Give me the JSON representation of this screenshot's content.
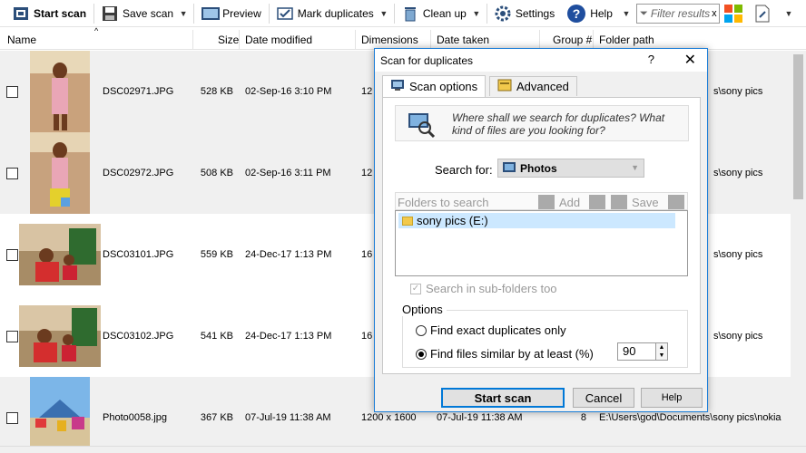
{
  "toolbar": {
    "start_scan": "Start scan",
    "save_scan": "Save scan",
    "preview": "Preview",
    "mark_duplicates": "Mark duplicates",
    "clean_up": "Clean up",
    "settings": "Settings",
    "help": "Help",
    "filter_placeholder": "Filter results",
    "filter_clear": "x"
  },
  "columns": {
    "name": "Name",
    "size": "Size",
    "date_modified": "Date modified",
    "dimensions": "Dimensions",
    "date_taken": "Date taken",
    "group": "Group #",
    "folder_path": "Folder path"
  },
  "rows": [
    {
      "name": "DSC02971.JPG",
      "size": "528 KB",
      "date_modified": "02-Sep-16 3:10 PM",
      "dimensions": "12",
      "date_taken": "",
      "group": "",
      "folder_path": "s\\sony pics"
    },
    {
      "name": "DSC02972.JPG",
      "size": "508 KB",
      "date_modified": "02-Sep-16 3:11 PM",
      "dimensions": "12",
      "date_taken": "",
      "group": "",
      "folder_path": "s\\sony pics"
    },
    {
      "name": "DSC03101.JPG",
      "size": "559 KB",
      "date_modified": "24-Dec-17 1:13 PM",
      "dimensions": "16",
      "date_taken": "",
      "group": "",
      "folder_path": "s\\sony pics"
    },
    {
      "name": "DSC03102.JPG",
      "size": "541 KB",
      "date_modified": "24-Dec-17 1:13 PM",
      "dimensions": "16",
      "date_taken": "",
      "group": "",
      "folder_path": "s\\sony pics"
    },
    {
      "name": "Photo0058.jpg",
      "size": "367 KB",
      "date_modified": "07-Jul-19 11:38 AM",
      "dimensions": "1200 x 1600",
      "date_taken": "07-Jul-19 11:38 AM",
      "group": "8",
      "folder_path": "E:\\Users\\god\\Documents\\sony pics\\nokia"
    }
  ],
  "dialog": {
    "title": "Scan for duplicates",
    "help_glyph": "?",
    "close_glyph": "✕",
    "tab_scan_options": "Scan options",
    "tab_advanced": "Advanced",
    "prompt": "Where shall we search for duplicates? What kind of files are you looking for?",
    "search_for_label": "Search for:",
    "search_for_value": "Photos",
    "folders_to_search": "Folders to search",
    "add_label": "Add",
    "save_label": "Save",
    "folder_item": "sony pics (E:)",
    "subfolders": "Search in sub-folders too",
    "options_label": "Options",
    "opt_exact": "Find exact duplicates only",
    "opt_similar": "Find files similar by at least (%)",
    "similarity_value": "90",
    "start_scan": "Start scan",
    "cancel": "Cancel",
    "help": "Help"
  }
}
